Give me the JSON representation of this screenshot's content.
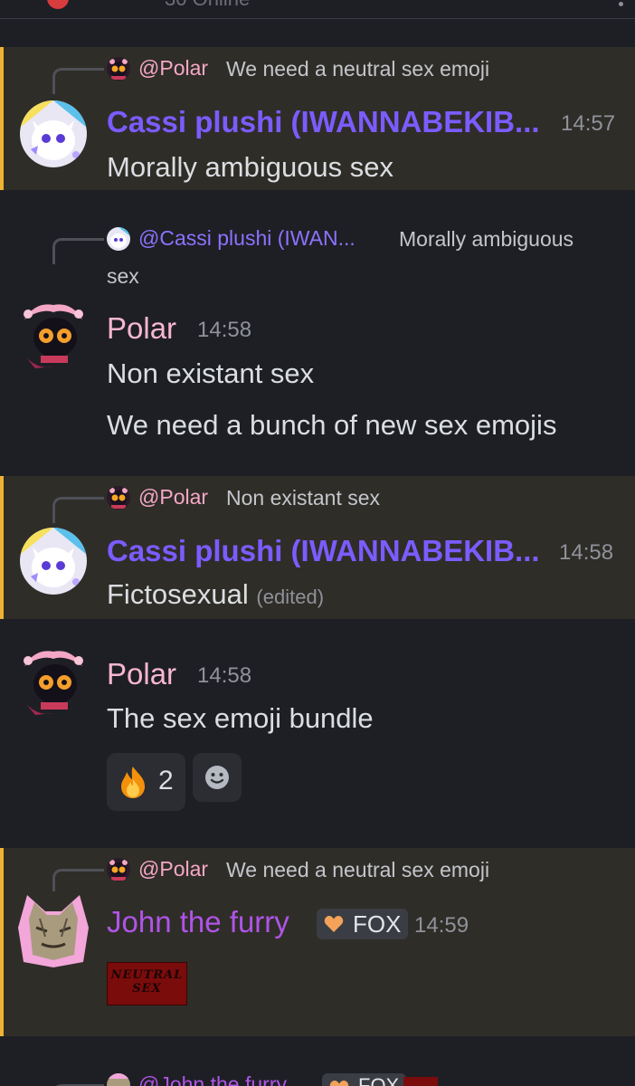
{
  "header": {
    "online_text": "30 Online"
  },
  "messages": [
    {
      "reply": {
        "name": "@Polar",
        "text": "We need a neutral sex emoji"
      },
      "author": "Cassi plushi (IWANNABEKIB...",
      "time": "14:57",
      "lines": [
        "Morally ambiguous sex"
      ]
    },
    {
      "reply": {
        "name": "@Cassi plushi (IWAN...",
        "text": "Morally ambiguous",
        "text2": "sex"
      },
      "author": "Polar",
      "time": "14:58",
      "lines": [
        "Non existant sex",
        "We need a bunch of new sex emojis"
      ]
    },
    {
      "reply": {
        "name": "@Polar",
        "text": "Non existant sex"
      },
      "author": "Cassi plushi (IWANNABEKIB...",
      "time": "14:58",
      "lines": [
        "Fictosexual"
      ],
      "edited": "(edited)"
    },
    {
      "author": "Polar",
      "time": "14:58",
      "lines": [
        "The sex emoji bundle"
      ],
      "reactions": [
        {
          "emoji": "fire-icon",
          "count": "2"
        }
      ]
    },
    {
      "reply": {
        "name": "@Polar",
        "text": "We need a neutral sex emoji"
      },
      "author": "John the furry",
      "tag": "FOX",
      "time": "14:59",
      "attachment_text": "NEUTRAL SEX"
    },
    {
      "reply": {
        "name": "@John the furry",
        "tag": "FOX"
      }
    }
  ],
  "colors": {
    "background": "#1e1f24",
    "mention_highlight": "#2f2d28",
    "mention_bar": "#f0b232",
    "cassi_name": "#7b5cff",
    "polar_name": "#f8b7cf",
    "john_name": "#b054e8"
  }
}
